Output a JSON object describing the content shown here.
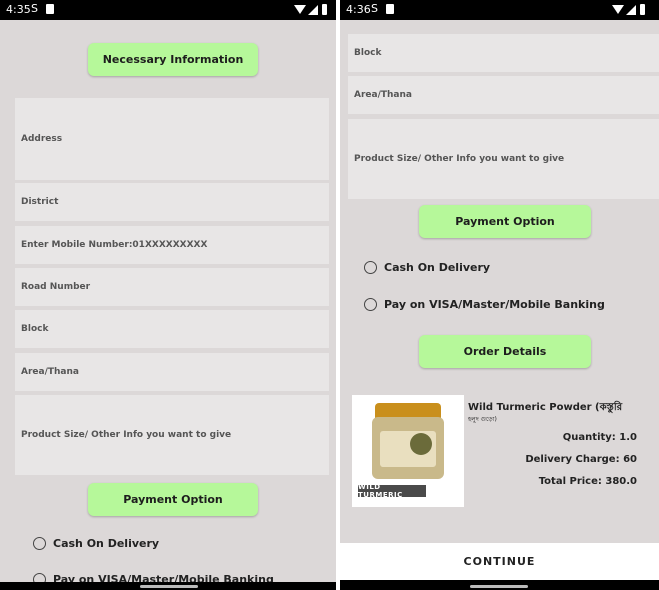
{
  "screen1": {
    "status": {
      "time": "4:35"
    },
    "header_button": "Necessary Information",
    "fields": [
      "Address",
      "District",
      "Enter Mobile Number:01XXXXXXXXX",
      "Road Number",
      "Block",
      "Area/Thana",
      "Product Size/ Other Info you want to give"
    ],
    "payment_button": "Payment Option",
    "radios": [
      "Cash On Delivery",
      "Pay on VISA/Master/Mobile Banking"
    ]
  },
  "screen2": {
    "status": {
      "time": "4:36"
    },
    "fields": [
      "Block",
      "Area/Thana",
      "Product Size/ Other Info you want to give"
    ],
    "payment_button": "Payment Option",
    "radios": [
      "Cash On Delivery",
      "Pay on VISA/Master/Mobile Banking"
    ],
    "order_button": "Order Details",
    "product": {
      "name": "Wild Turmeric Powder (কস্তুরি",
      "name_line2": "হলুদ গুড়ো)",
      "image_brand": "WILD TURMERIC",
      "quantity": "Quantity: 1.0",
      "delivery": "Delivery Charge: 60",
      "total": "Total Price: 380.0"
    },
    "continue": "CONTINUE"
  },
  "colors": {
    "background": "#dcd8d8",
    "field": "#e8e6e6",
    "accent_green": "#b6f89a"
  },
  "icons": [
    "sim-icon",
    "wifi-icon",
    "signal-icon",
    "battery-icon",
    "radio-button-icon"
  ]
}
